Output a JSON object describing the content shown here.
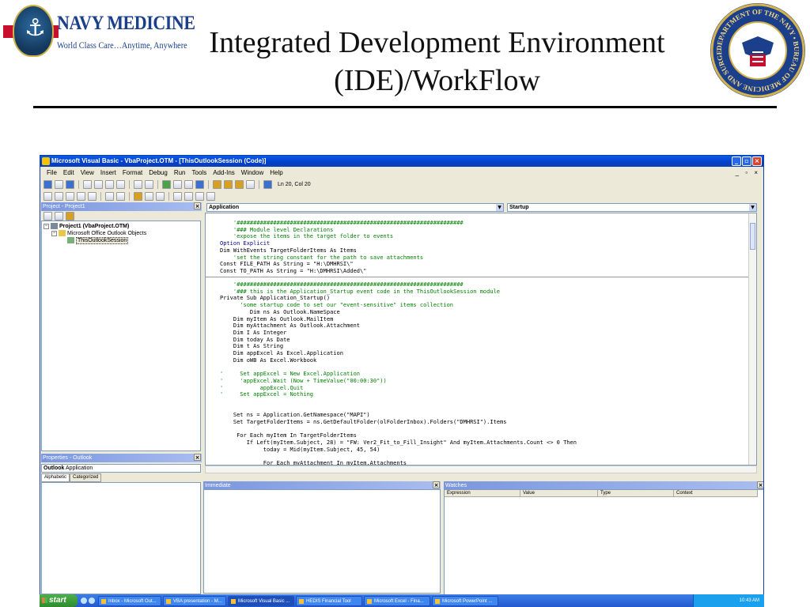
{
  "slide": {
    "title_line1": "Integrated Development Environment",
    "title_line2": "(IDE)/WorkFlow",
    "logo_name": "NAVY MEDICINE",
    "logo_tagline": "World Class Care…Anytime, Anywhere",
    "seal_text": "DEPARTMENT OF THE NAVY • BUREAU OF MEDICINE AND SURGERY"
  },
  "window": {
    "title": "Microsoft Visual Basic - VbaProject.OTM - [ThisOutlookSession (Code)]",
    "menus": [
      "File",
      "Edit",
      "View",
      "Insert",
      "Format",
      "Debug",
      "Run",
      "Tools",
      "Add-Ins",
      "Window",
      "Help"
    ],
    "cursor_position": "Ln 20, Col 20"
  },
  "project_pane": {
    "title": "Project - Project1",
    "tree": [
      {
        "label": "Project1 (VbaProject.OTM)"
      },
      {
        "label": "Microsoft Office Outlook Objects"
      },
      {
        "label": "ThisOutlookSession"
      }
    ]
  },
  "properties_pane": {
    "title": "Properties - Outlook",
    "object_name": "Outlook",
    "object_type": "Application",
    "tabs": [
      "Alphabetic",
      "Categorized"
    ]
  },
  "code_window": {
    "object_combo": "Application",
    "procedure_combo": "Startup",
    "lines_top": [
      {
        "t": "    '####################################################################",
        "c": "cm"
      },
      {
        "t": "    '### Module level Declarations",
        "c": "cm"
      },
      {
        "t": "    'expose the items in the target folder to events",
        "c": "cm"
      },
      {
        "t": "Option Explicit",
        "c": "kw"
      },
      {
        "t": "Dim WithEvents TargetFolderItems As Items",
        "c": ""
      },
      {
        "t": "    'set the string constant for the path to save attachments",
        "c": "cm"
      },
      {
        "t": "Const FILE_PATH As String = \"H:\\DMHRSI\\\"",
        "c": ""
      },
      {
        "t": "Const TO_PATH As String = \"H:\\DMHRSI\\Added\\\"",
        "c": ""
      }
    ],
    "lines_bottom": [
      {
        "t": "    '####################################################################",
        "c": "cm"
      },
      {
        "t": "    '### this is the Application_Startup event code in the ThisOutlookSession module",
        "c": "cm"
      },
      {
        "t": "Private Sub Application_Startup()",
        "c": ""
      },
      {
        "t": "      'some startup code to set our \"event-sensitive\" items collection",
        "c": "cm"
      },
      {
        "t": "         Dim ns As Outlook.NameSpace",
        "c": ""
      },
      {
        "t": "    Dim myItem As Outlook.MailItem",
        "c": ""
      },
      {
        "t": "    Dim myAttachment As Outlook.Attachment",
        "c": ""
      },
      {
        "t": "    Dim I As Integer",
        "c": ""
      },
      {
        "t": "    Dim today As Date",
        "c": ""
      },
      {
        "t": "    Dim t As String",
        "c": ""
      },
      {
        "t": "    Dim appExcel As Excel.Application",
        "c": ""
      },
      {
        "t": "    Dim oWB As Excel.Workbook",
        "c": ""
      },
      {
        "t": "",
        "c": ""
      },
      {
        "t": "'     Set appExcel = New Excel.Application",
        "c": "cm"
      },
      {
        "t": "'     'appExcel.Wait (Now + TimeValue(\"00:00:30\"))",
        "c": "cm"
      },
      {
        "t": "'           appExcel.Quit",
        "c": "cm"
      },
      {
        "t": "'     Set appExcel = Nothing",
        "c": "cm"
      },
      {
        "t": "",
        "c": ""
      },
      {
        "t": "",
        "c": ""
      },
      {
        "t": "    Set ns = Application.GetNamespace(\"MAPI\")",
        "c": ""
      },
      {
        "t": "    Set TargetFolderItems = ns.GetDefaultFolder(olFolderInbox).Folders(\"DMHRSI\").Items",
        "c": ""
      },
      {
        "t": "",
        "c": ""
      },
      {
        "t": "     For Each myItem In TargetFolderItems",
        "c": ""
      },
      {
        "t": "        If Left(myItem.Subject, 28) = \"FW: Ver2_Fit_to_Fill_Insight\" And myItem.Attachments.Count <> 0 Then",
        "c": ""
      },
      {
        "t": "             today = Mid(myItem.Subject, 45, 54)",
        "c": ""
      },
      {
        "t": "",
        "c": ""
      },
      {
        "t": "             For Each myAttachment In myItem.Attachments",
        "c": ""
      }
    ]
  },
  "immediate_pane": {
    "title": "Immediate"
  },
  "watches_pane": {
    "title": "Watches",
    "columns": [
      "Expression",
      "Value",
      "Type",
      "Context"
    ]
  },
  "taskbar": {
    "start_label": "start",
    "tasks": [
      {
        "label": "Inbox - Microsoft Out..."
      },
      {
        "label": "VBA presentation - M..."
      },
      {
        "label": "Microsoft Visual Basic ..."
      },
      {
        "label": "HEDIS Financial Tool"
      },
      {
        "label": "Microsoft Excel - Fina..."
      },
      {
        "label": "Microsoft PowerPoint ..."
      }
    ],
    "clock": "10:43 AM"
  },
  "colors": {
    "titlebar": "#0a5ae8",
    "code_comment": "#008000",
    "code_keyword": "#00007f",
    "taskbar": "#2458d0"
  }
}
